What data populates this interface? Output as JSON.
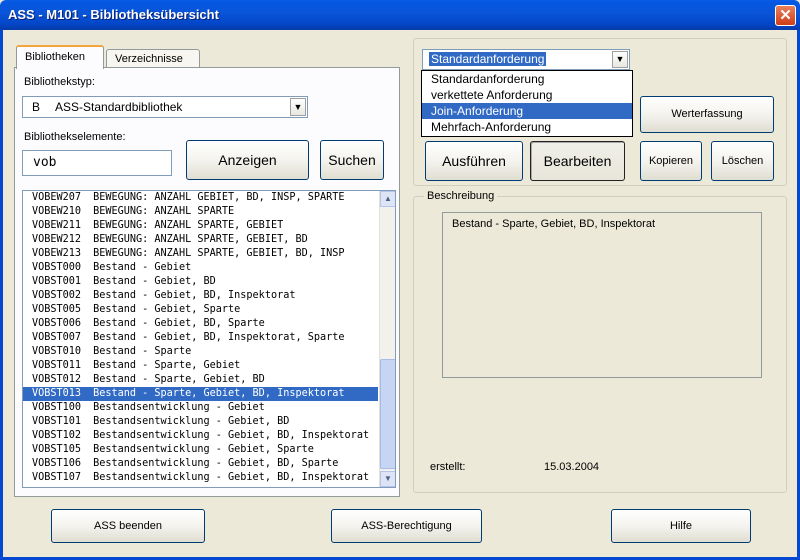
{
  "window": {
    "title": "ASS - M101 - Bibliotheksübersicht",
    "close_glyph": "✕"
  },
  "tabs": [
    {
      "label": "Bibliotheken",
      "active": true
    },
    {
      "label": "Verzeichnisse",
      "active": false
    }
  ],
  "library_type": {
    "label": "Bibliothekstyp:",
    "code": "B",
    "value": "ASS-Standardbibliothek"
  },
  "library_elements": {
    "label": "Bibliothekselemente:",
    "search_value": "vob"
  },
  "buttons": {
    "anzeigen": "Anzeigen",
    "suchen": "Suchen",
    "ausfuehren": "Ausführen",
    "bearbeiten": "Bearbeiten",
    "werterfassung": "Werterfassung",
    "kopieren": "Kopieren",
    "loeschen": "Löschen",
    "ass_beenden": "ASS beenden",
    "ass_berechtigung": "ASS-Berechtigung",
    "hilfe": "Hilfe"
  },
  "list_items": [
    {
      "code": "VOBEW207",
      "desc": "BEWEGUNG: ANZAHL GEBIET, BD, INSP, SPARTE"
    },
    {
      "code": "VOBEW210",
      "desc": "BEWEGUNG: ANZAHL SPARTE"
    },
    {
      "code": "VOBEW211",
      "desc": "BEWEGUNG: ANZAHL SPARTE, GEBIET"
    },
    {
      "code": "VOBEW212",
      "desc": "BEWEGUNG: ANZAHL SPARTE, GEBIET, BD"
    },
    {
      "code": "VOBEW213",
      "desc": "BEWEGUNG: ANZAHL SPARTE, GEBIET, BD, INSP"
    },
    {
      "code": "VOBST000",
      "desc": "Bestand - Gebiet"
    },
    {
      "code": "VOBST001",
      "desc": "Bestand - Gebiet, BD"
    },
    {
      "code": "VOBST002",
      "desc": "Bestand - Gebiet, BD, Inspektorat"
    },
    {
      "code": "VOBST005",
      "desc": "Bestand - Gebiet, Sparte"
    },
    {
      "code": "VOBST006",
      "desc": "Bestand - Gebiet, BD, Sparte"
    },
    {
      "code": "VOBST007",
      "desc": "Bestand - Gebiet, BD, Inspektorat, Sparte"
    },
    {
      "code": "VOBST010",
      "desc": "Bestand - Sparte"
    },
    {
      "code": "VOBST011",
      "desc": "Bestand - Sparte, Gebiet"
    },
    {
      "code": "VOBST012",
      "desc": "Bestand - Sparte, Gebiet, BD"
    },
    {
      "code": "VOBST013",
      "desc": "Bestand - Sparte, Gebiet, BD, Inspektorat",
      "selected": true
    },
    {
      "code": "VOBST100",
      "desc": "Bestandsentwicklung - Gebiet"
    },
    {
      "code": "VOBST101",
      "desc": "Bestandsentwicklung - Gebiet, BD"
    },
    {
      "code": "VOBST102",
      "desc": "Bestandsentwicklung - Gebiet, BD, Inspektorat"
    },
    {
      "code": "VOBST105",
      "desc": "Bestandsentwicklung - Gebiet, Sparte"
    },
    {
      "code": "VOBST106",
      "desc": "Bestandsentwicklung - Gebiet, BD, Sparte"
    },
    {
      "code": "VOBST107",
      "desc": "Bestandsentwicklung - Gebiet, BD, Inspektorat"
    }
  ],
  "request_type": {
    "value": "Standardanforderung",
    "options": [
      {
        "label": "Standardanforderung",
        "selected": false
      },
      {
        "label": "verkettete Anforderung",
        "selected": false
      },
      {
        "label": "Join-Anforderung",
        "selected": true
      },
      {
        "label": "Mehrfach-Anforderung",
        "selected": false
      }
    ]
  },
  "description": {
    "caption": "Beschreibung",
    "text": "Bestand - Sparte, Gebiet, BD, Inspektorat",
    "created_label": "erstellt:",
    "created_date": "15.03.2004"
  },
  "icons": {
    "dropdown": "▼",
    "scroll_up": "▲",
    "scroll_down": "▼"
  }
}
